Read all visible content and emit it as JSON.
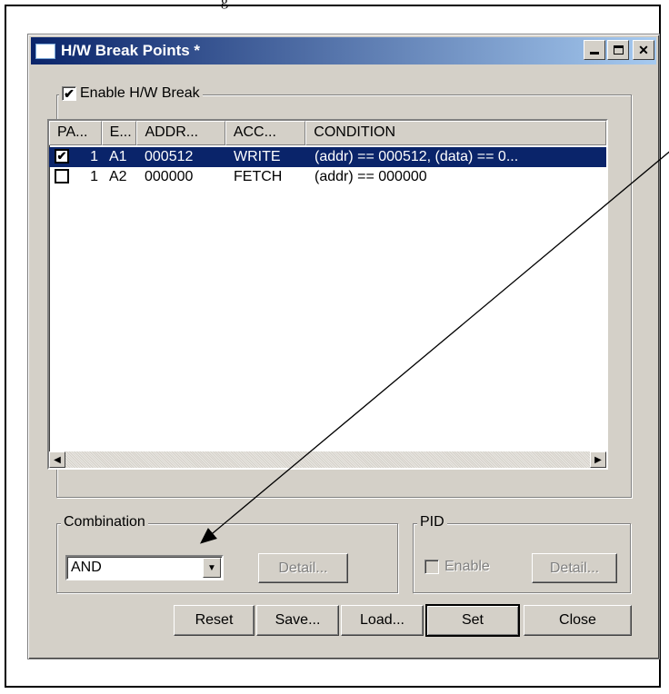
{
  "caption_fragment": "g",
  "window": {
    "title": "H/W Break Points *",
    "buttons": [
      "minimize",
      "maximize",
      "close"
    ]
  },
  "enable_group": {
    "label": "Enable H/W Break",
    "checked": true
  },
  "list": {
    "columns": [
      "PA...",
      "E...",
      "ADDR...",
      "ACC...",
      "CONDITION"
    ],
    "rows": [
      {
        "checked": true,
        "pass": "1",
        "event": "A1",
        "addr": "000512",
        "access": "WRITE",
        "condition": "(addr) == 000512, (data) == 0...",
        "selected": true
      },
      {
        "checked": false,
        "pass": "1",
        "event": "A2",
        "addr": "000000",
        "access": "FETCH",
        "condition": "(addr) == 000000",
        "selected": false
      }
    ]
  },
  "combination": {
    "label": "Combination",
    "value": "AND",
    "detail_label": "Detail..."
  },
  "pid": {
    "label": "PID",
    "enable_label": "Enable",
    "detail_label": "Detail..."
  },
  "buttons": {
    "reset": "Reset",
    "save": "Save...",
    "load": "Load...",
    "set": "Set",
    "close": "Close"
  },
  "colors": {
    "title_start": "#0a246a",
    "title_end": "#a6caf0",
    "selection": "#0a246a",
    "dialog_bg": "#d4d0c8"
  }
}
